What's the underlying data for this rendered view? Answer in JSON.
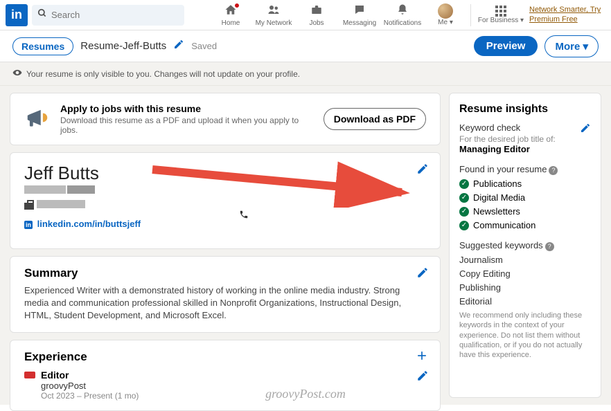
{
  "nav": {
    "search_placeholder": "Search",
    "items": [
      "Home",
      "My Network",
      "Jobs",
      "Messaging",
      "Notifications",
      "Me"
    ],
    "business": "For Business",
    "promo": "Network Smarter, Try Premium Free"
  },
  "subbar": {
    "resumes": "Resumes",
    "name": "Resume-Jeff-Butts",
    "saved": "Saved",
    "preview": "Preview",
    "more": "More"
  },
  "banner": "Your resume is only visible to you. Changes will not update on your profile.",
  "apply": {
    "title": "Apply to jobs with this resume",
    "sub": "Download this resume as a PDF and upload it when you apply to jobs.",
    "btn": "Download as PDF"
  },
  "profile": {
    "name": "Jeff Butts",
    "url_label": "linkedin.com/in/buttsjeff"
  },
  "summary": {
    "title": "Summary",
    "body": "Experienced Writer with a demonstrated history of working in the online media industry. Strong media and communication professional skilled in Nonprofit Organizations, Instructional Design, HTML, Student Development, and Microsoft Excel."
  },
  "experience": {
    "title": "Experience",
    "items": [
      {
        "title": "Editor",
        "company": "groovyPost",
        "date": "Oct 2023 – Present (1 mo)"
      }
    ]
  },
  "insights": {
    "title": "Resume insights",
    "kwcheck_label": "Keyword check",
    "kwcheck_sub": "For the desired job title of:",
    "job_title": "Managing Editor",
    "found_label": "Found in your resume",
    "found": [
      "Publications",
      "Digital Media",
      "Newsletters",
      "Communication"
    ],
    "suggested_label": "Suggested keywords",
    "suggested": [
      "Journalism",
      "Copy Editing",
      "Publishing",
      "Editorial"
    ],
    "note": "We recommend only including these keywords in the context of your experience. Do not list them without qualification, or if you do not actually have this experience."
  },
  "watermark": "groovyPost.com"
}
